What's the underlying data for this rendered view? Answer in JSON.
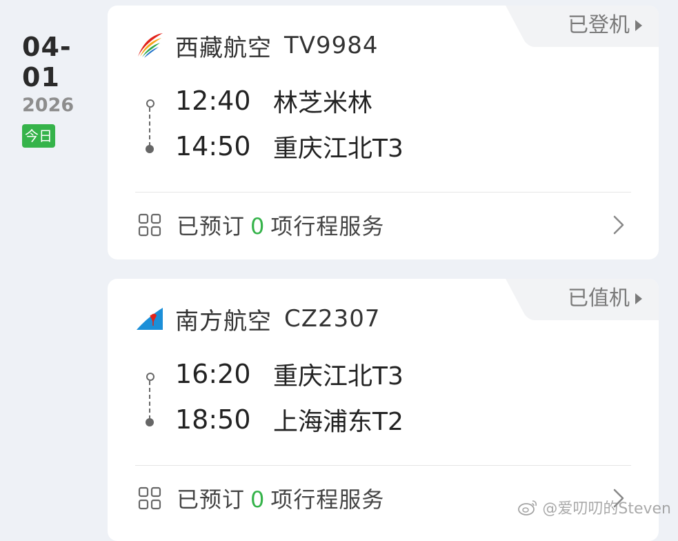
{
  "date": {
    "month_day": "04-01",
    "year": "2026",
    "today_label": "今日"
  },
  "flights": [
    {
      "status": "已登机",
      "airline": "西藏航空",
      "flight_no": "TV9984",
      "logo_icon": "tibet-airlines-logo-icon",
      "depart_time": "12:40",
      "depart_place": "林芝米林",
      "arrive_time": "14:50",
      "arrive_place": "重庆江北T3",
      "services_prefix": "已预订",
      "services_count": "0",
      "services_suffix": "项行程服务"
    },
    {
      "status": "已值机",
      "airline": "南方航空",
      "flight_no": "CZ2307",
      "logo_icon": "china-southern-logo-icon",
      "depart_time": "16:20",
      "depart_place": "重庆江北T3",
      "arrive_time": "18:50",
      "arrive_place": "上海浦东T2",
      "services_prefix": "已预订",
      "services_count": "0",
      "services_suffix": "项行程服务"
    }
  ],
  "watermark": "@爱叨叨的Steven",
  "colors": {
    "background": "#eef1f6",
    "card": "#ffffff",
    "accent_green": "#35b34a",
    "status_tab": "#f2f3f5",
    "china_southern_blue": "#1b8fd8",
    "china_southern_red": "#e2231a"
  }
}
